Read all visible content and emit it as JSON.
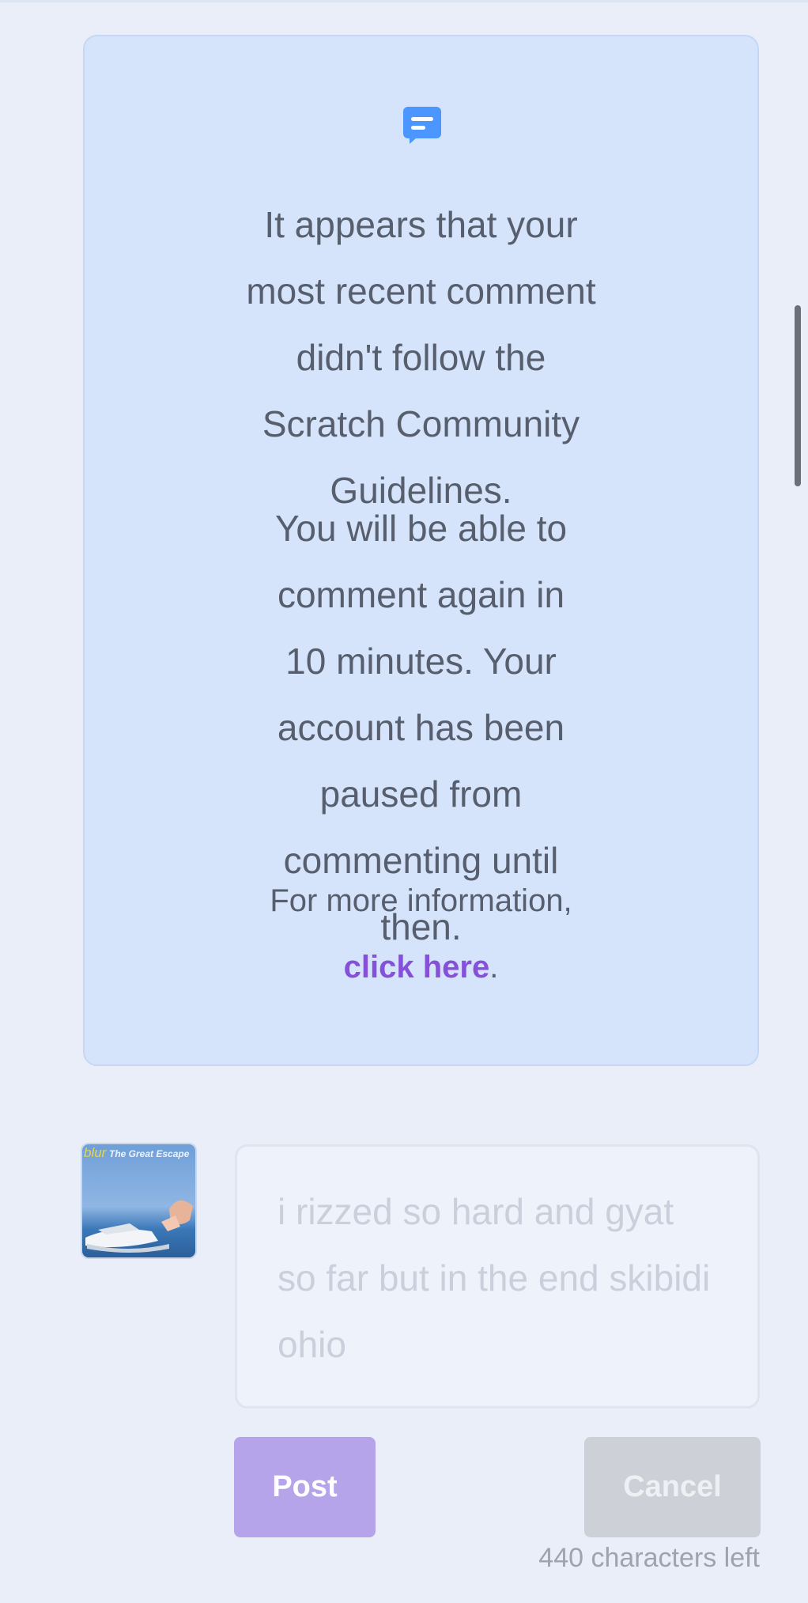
{
  "notice": {
    "icon": "comment-icon",
    "main_message": "It appears that your most recent comment didn't follow the Scratch Community Guidelines.",
    "pause_message": "You will be able to comment again in 10 minutes. Your account has been paused from commenting until then.",
    "info_prefix": "For more information,",
    "info_link": "click here",
    "info_suffix": "."
  },
  "composer": {
    "avatar_text": {
      "band": "blur",
      "album": "The Great Escape"
    },
    "comment_text": "i rizzed so hard and gyat so far but in the end skibidi ohio",
    "post_label": "Post",
    "cancel_label": "Cancel",
    "char_count": "440 characters left"
  },
  "colors": {
    "background": "#e9eef9",
    "notice_background": "#d6e4fb",
    "link": "#8551d8",
    "post_button": "#b6a4ea",
    "cancel_button": "#cdd0d6",
    "icon": "#4c97ff"
  }
}
